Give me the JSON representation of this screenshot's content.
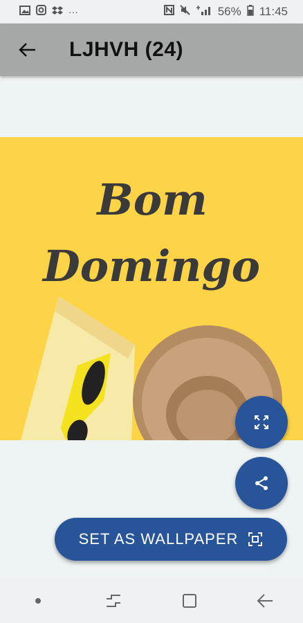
{
  "status_bar": {
    "icons_left": [
      "image-icon",
      "instagram-icon",
      "dropbox-icon",
      "more-dots-icon"
    ],
    "more_dots": "···",
    "icons_right": [
      "nfc-icon",
      "mute-icon",
      "signal-icon",
      "battery-icon"
    ],
    "battery": "56%",
    "time": "11:45"
  },
  "app_bar": {
    "title": "LJHVH (24)"
  },
  "wallpaper": {
    "text_line1": "Bom",
    "text_line2": "Domingo",
    "colors": {
      "background": "#fdd448",
      "towel": "#f7e9a8",
      "hat": "#c9a17c",
      "sunglasses": "#f5e21f"
    }
  },
  "actions": {
    "expand_icon": "fullscreen-icon",
    "share_icon": "share-icon",
    "set_wallpaper_label": "SET AS WALLPAPER",
    "set_wallpaper_icon": "wallpaper-icon",
    "accent_color": "#28549a"
  },
  "nav_bar": {
    "items": [
      "dot-icon",
      "recent-apps-icon",
      "home-icon",
      "back-arrow-icon"
    ]
  }
}
